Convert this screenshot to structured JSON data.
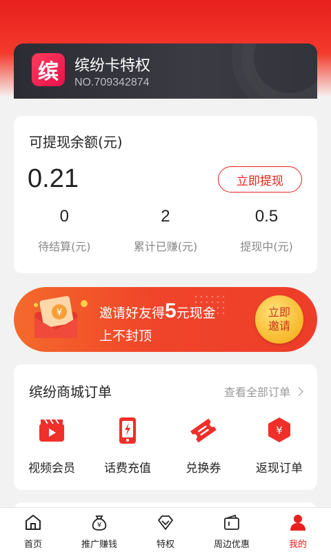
{
  "card": {
    "logo_text": "缤",
    "title": "缤纷卡特权",
    "number": "NO.709342874"
  },
  "balance": {
    "title": "可提现余额(元)",
    "amount": "0.21",
    "withdraw_label": "立即提现",
    "stats": [
      {
        "value": "0",
        "label": "待结算(元)"
      },
      {
        "value": "2",
        "label": "累计已赚(元)"
      },
      {
        "value": "0.5",
        "label": "提现中(元)"
      }
    ]
  },
  "banner": {
    "line1_prefix": "邀请好友得",
    "line1_amount": "5",
    "line1_suffix": "元现金",
    "line2": "上不封顶",
    "button_line1": "立即",
    "button_line2": "邀请"
  },
  "orders": {
    "title": "缤纷商城订单",
    "view_all": "查看全部订单",
    "items": [
      {
        "label": "视频会员",
        "icon": "video-member-icon"
      },
      {
        "label": "话费充值",
        "icon": "phone-recharge-icon"
      },
      {
        "label": "兑换券",
        "icon": "coupon-icon"
      },
      {
        "label": "返现订单",
        "icon": "cashback-icon"
      }
    ]
  },
  "tabbar": {
    "items": [
      {
        "label": "首页",
        "icon": "home-icon",
        "active": false
      },
      {
        "label": "推广赚钱",
        "icon": "money-bag-icon",
        "active": false
      },
      {
        "label": "特权",
        "icon": "diamond-icon",
        "active": false
      },
      {
        "label": "周边优惠",
        "icon": "wallet-icon",
        "active": false
      },
      {
        "label": "我的",
        "icon": "user-icon",
        "active": true
      }
    ]
  },
  "colors": {
    "accent": "#e8201e",
    "card_bg": "#2c2c34",
    "banner_start": "#f46a2b",
    "banner_end": "#ee3d2a",
    "invite_gold": "#f7b82a"
  }
}
